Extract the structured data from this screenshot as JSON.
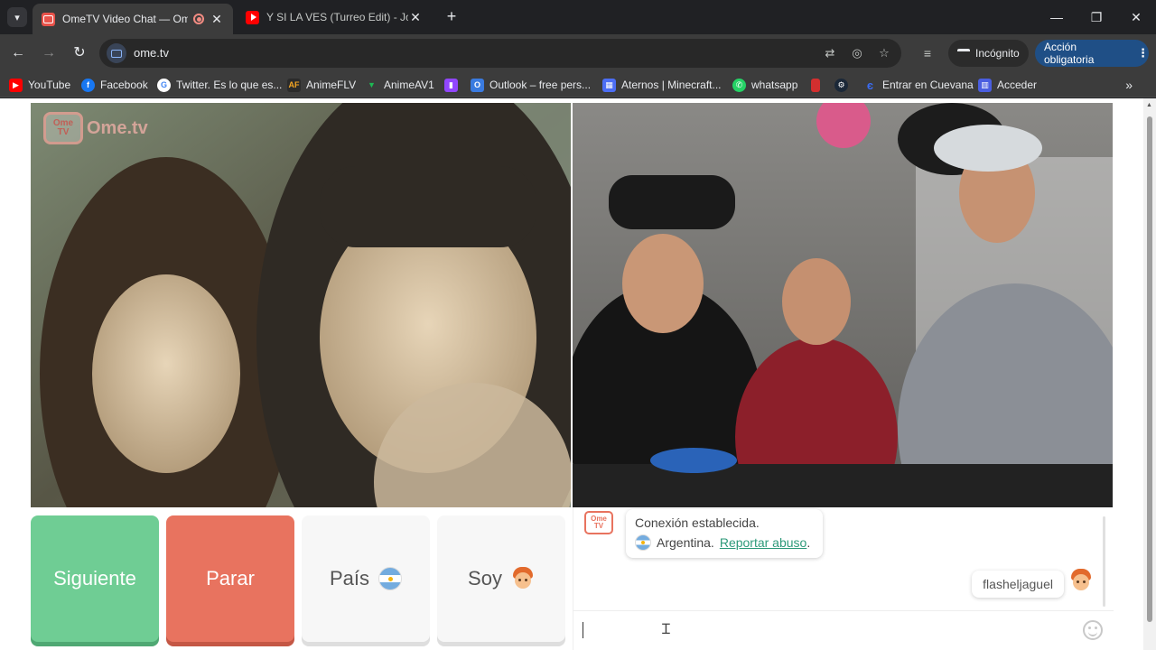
{
  "tabs": [
    {
      "title": "OmeTV Video Chat — Ome",
      "active": true
    },
    {
      "title": "Y SI LA VES (Turreo Edit) - Jona",
      "active": false
    }
  ],
  "toolbar": {
    "url": "ome.tv",
    "incognito_label": "Incógnito",
    "action_label": "Acción obligatoria"
  },
  "bookmarks": [
    {
      "label": "YouTube",
      "icon": "youtube-icon",
      "color": "#ff0000"
    },
    {
      "label": "Facebook",
      "icon": "facebook-icon",
      "color": "#1877f2"
    },
    {
      "label": "Twitter. Es lo que es...",
      "icon": "google-icon",
      "color": "#ffffff"
    },
    {
      "label": "AnimeFLV",
      "icon": "animeflv-icon",
      "color": "#2b2b2b"
    },
    {
      "label": "AnimeAV1",
      "icon": "animeav1-icon",
      "color": "#1db954"
    },
    {
      "label": "",
      "icon": "twitch-icon",
      "color": "#9146ff"
    },
    {
      "label": "Outlook – free pers...",
      "icon": "outlook-icon",
      "color": "#3a7be0"
    },
    {
      "label": "Aternos | Minecraft...",
      "icon": "aternos-icon",
      "color": "#4c6ef5"
    },
    {
      "label": "whatsapp",
      "icon": "whatsapp-icon",
      "color": "#25d366"
    },
    {
      "label": "",
      "icon": "red-bookmark-icon",
      "color": "#d32f2f"
    },
    {
      "label": "",
      "icon": "steam-icon",
      "color": "#1b2838"
    },
    {
      "label": "Entrar en Cuevana",
      "icon": "cuevana-icon",
      "color": "#3a6cf4"
    },
    {
      "label": "Acceder",
      "icon": "acceder-icon",
      "color": "#4a5ee0"
    }
  ],
  "page": {
    "logo_text": "Ome.tv",
    "buttons": {
      "next": "Siguiente",
      "stop": "Parar",
      "country": "País",
      "me": "Soy"
    },
    "chat": {
      "system_line1": "Conexión establecida.",
      "country": "Argentina.",
      "report_link": "Reportar abuso",
      "report_suffix": ".",
      "user_message": "flasheljaguel",
      "input_value": ""
    }
  },
  "colors": {
    "next_button": "#6fcd94",
    "stop_button": "#e8735f",
    "link": "#2e9a7a",
    "action_button": "#1f4f86"
  }
}
